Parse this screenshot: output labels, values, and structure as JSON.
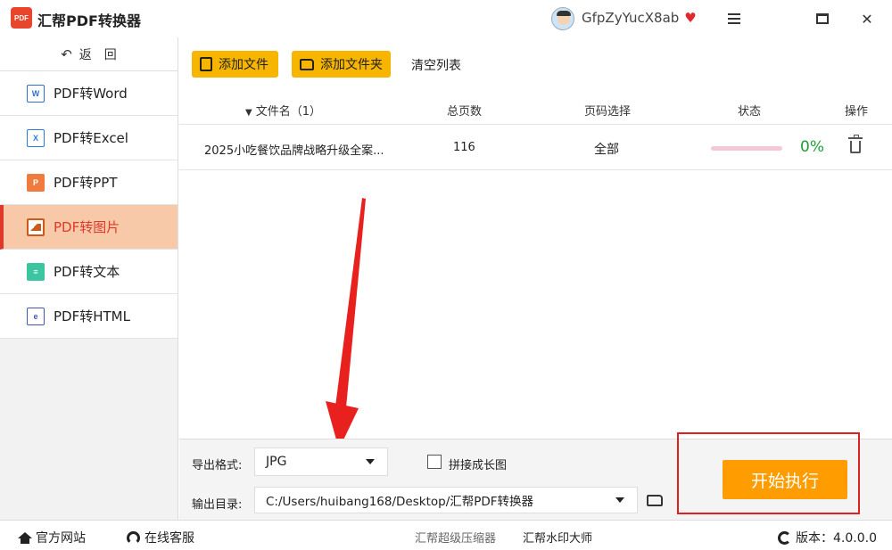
{
  "app": {
    "logo_text": "PDF",
    "title": "汇帮PDF转换器",
    "username": "GfpZyYucX8ab"
  },
  "sidebar": {
    "back_label": "返　回",
    "items": [
      {
        "label": "PDF转Word",
        "icon": "word-icon"
      },
      {
        "label": "PDF转Excel",
        "icon": "excel-icon"
      },
      {
        "label": "PDF转PPT",
        "icon": "ppt-icon"
      },
      {
        "label": "PDF转图片",
        "icon": "image-icon",
        "active": true
      },
      {
        "label": "PDF转文本",
        "icon": "text-icon"
      },
      {
        "label": "PDF转HTML",
        "icon": "html-icon"
      }
    ]
  },
  "toolbar": {
    "add_file": "添加文件",
    "add_folder": "添加文件夹",
    "clear_list": "清空列表"
  },
  "table": {
    "columns": {
      "name": "文件名（1）",
      "pages": "总页数",
      "range": "页码选择",
      "status": "状态",
      "op": "操作"
    },
    "rows": [
      {
        "name": "2025小吃餐饮品牌战略升级全案...",
        "pages": "116",
        "range": "全部",
        "progress": 0,
        "progress_text": "0%"
      }
    ]
  },
  "settings": {
    "format_label": "导出格式:",
    "format_value": "JPG",
    "merge_label": "拼接成长图",
    "merge_checked": false,
    "dir_label": "输出目录:",
    "dir_value": "C:/Users/huibang168/Desktop/汇帮PDF转换器",
    "start_button": "开始执行"
  },
  "footer": {
    "site": "官方网站",
    "service": "在线客服",
    "compress": "汇帮超级压缩器",
    "watermark": "汇帮水印大师",
    "version": "版本：4.0.0.0"
  },
  "colors": {
    "accent": "#e0382a",
    "button_yellow": "#f7b500",
    "start_orange": "#ff9c00",
    "progress_green": "#1e9e3a"
  }
}
